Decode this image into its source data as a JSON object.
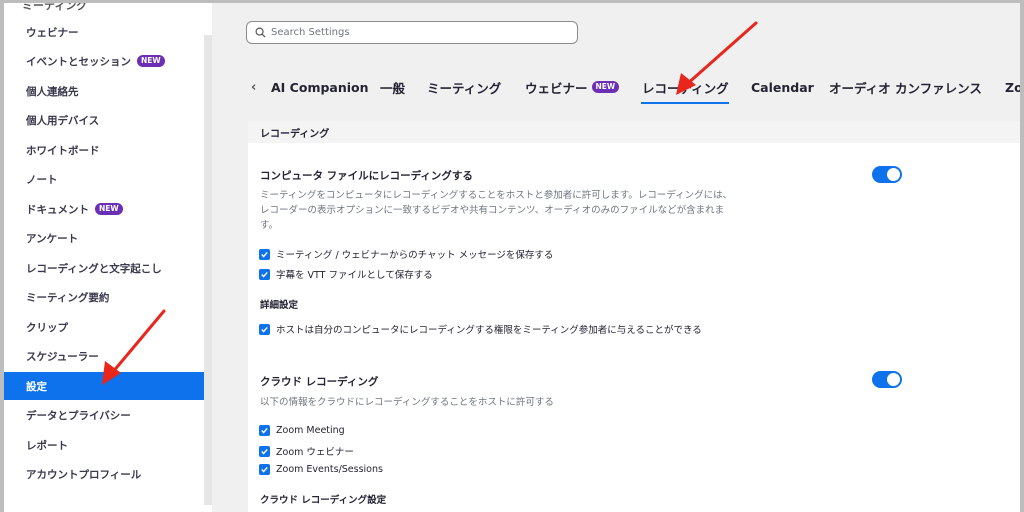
{
  "sidebar": {
    "top_cut": "ミーティング",
    "items": [
      {
        "label": "ウェビナー",
        "badge": ""
      },
      {
        "label": "イベントとセッション",
        "badge": "NEW"
      },
      {
        "label": "個人連絡先",
        "badge": ""
      },
      {
        "label": "個人用デバイス",
        "badge": ""
      },
      {
        "label": "ホワイトボード",
        "badge": ""
      },
      {
        "label": "ノート",
        "badge": ""
      },
      {
        "label": "ドキュメント",
        "badge": "NEW"
      },
      {
        "label": "アンケート",
        "badge": ""
      },
      {
        "label": "レコーディングと文字起こし",
        "badge": ""
      },
      {
        "label": "ミーティング要約",
        "badge": ""
      },
      {
        "label": "クリップ",
        "badge": ""
      },
      {
        "label": "スケジューラー",
        "badge": ""
      },
      {
        "label": "設定",
        "badge": "",
        "active": true
      },
      {
        "label": "データとプライバシー",
        "badge": ""
      },
      {
        "label": "レポート",
        "badge": ""
      },
      {
        "label": "アカウントプロフィール",
        "badge": ""
      }
    ]
  },
  "search": {
    "placeholder": "Search Settings"
  },
  "tabs": {
    "items": [
      "AI Companion",
      "一般",
      "ミーティング",
      "ウェビナー",
      "レコーディング",
      "Calendar",
      "オーディオ カンファレンス",
      "Zo"
    ],
    "webinar_badge": "NEW",
    "active": "レコーディング"
  },
  "section": {
    "title": "レコーディング",
    "local": {
      "title": "コンピュータ ファイルにレコーディングする",
      "desc_line1": "ミーティングをコンピュータにレコーディングすることをホストと参加者に許可します。レコーディングには、",
      "desc_line2": "レコーダーの表示オプションに一致するビデオや共有コンテンツ、オーディオのみのファイルなどが含まれま",
      "desc_line3": "す。",
      "check1": "ミーティング / ウェビナーからのチャット メッセージを保存する",
      "check2": "字幕を VTT ファイルとして保存する",
      "advanced_title": "詳細設定",
      "check3": "ホストは自分のコンピュータにレコーディングする権限をミーティング参加者に与えることができる"
    },
    "cloud": {
      "title": "クラウド レコーディング",
      "desc": "以下の情報をクラウドにレコーディングすることをホストに許可する",
      "check1": "Zoom Meeting",
      "check2": "Zoom ウェビナー",
      "check3": "Zoom Events/Sessions",
      "settings_title": "クラウド レコーディング設定"
    }
  },
  "colors": {
    "accent": "#0e72ed",
    "arrow": "#e8261c",
    "badge": "#6b2fb5"
  }
}
